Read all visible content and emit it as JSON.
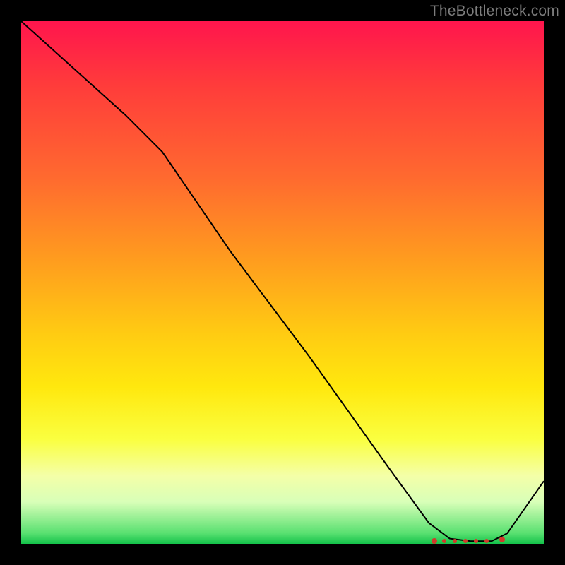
{
  "watermark": "TheBottleneck.com",
  "chart_data": {
    "type": "line",
    "title": "",
    "xlabel": "",
    "ylabel": "",
    "xlim": [
      0,
      100
    ],
    "ylim": [
      0,
      100
    ],
    "series": [
      {
        "name": "curve",
        "x": [
          0,
          10,
          20,
          27,
          40,
          55,
          70,
          78,
          82,
          86,
          90,
          93,
          100
        ],
        "y": [
          100,
          91,
          82,
          75,
          56,
          36,
          15,
          4,
          1,
          0.5,
          0.5,
          2,
          12
        ]
      }
    ],
    "markers": {
      "name": "highlight-cluster",
      "x": [
        79,
        81,
        83,
        85,
        87,
        89,
        92
      ],
      "y": [
        0.6,
        0.5,
        0.5,
        0.5,
        0.5,
        0.6,
        0.8
      ]
    },
    "gradient_stops": [
      {
        "pos": 0,
        "color": "#ff154d"
      },
      {
        "pos": 12,
        "color": "#ff3b3b"
      },
      {
        "pos": 30,
        "color": "#ff6a2f"
      },
      {
        "pos": 45,
        "color": "#ff9a1f"
      },
      {
        "pos": 60,
        "color": "#ffcc12"
      },
      {
        "pos": 70,
        "color": "#ffe80e"
      },
      {
        "pos": 80,
        "color": "#faff40"
      },
      {
        "pos": 87,
        "color": "#f4ffa8"
      },
      {
        "pos": 92,
        "color": "#d8ffb8"
      },
      {
        "pos": 98,
        "color": "#58e070"
      },
      {
        "pos": 100,
        "color": "#14c24a"
      }
    ]
  }
}
